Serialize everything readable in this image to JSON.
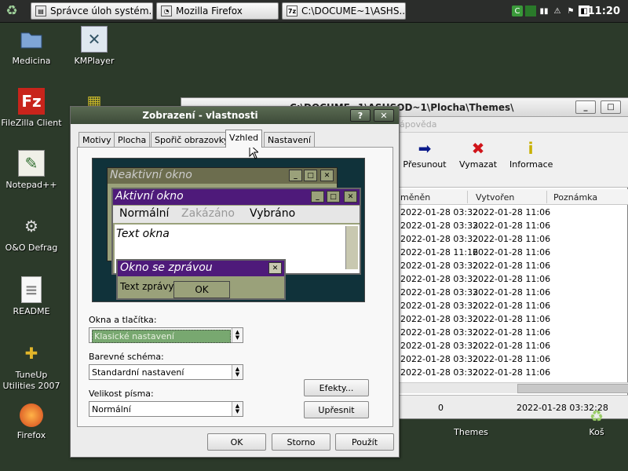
{
  "taskbar": {
    "start_icon": "recycle-leaf-icon",
    "tasks": [
      {
        "label": "Správce úloh systém...",
        "icon": "taskmanager-icon"
      },
      {
        "label": "Mozilla Firefox",
        "icon": "firefox-icon"
      },
      {
        "label": "C:\\DOCUME~1\\ASHS...",
        "icon": "7zip-icon"
      }
    ],
    "tray_icons": [
      "green-c-icon",
      "network-icon",
      "signal-icon",
      "usb-icon",
      "flag-icon",
      "display-icon"
    ],
    "clock": "11:20"
  },
  "desktop_icons": [
    {
      "label": "Medicina",
      "icon": "folder-icon"
    },
    {
      "label": "KMPlayer",
      "icon": "kmplayer-icon"
    },
    {
      "label": "FileZilla Client",
      "icon": "filezilla-icon"
    },
    {
      "label": "Notepad++",
      "icon": "notepad-icon"
    },
    {
      "label": "O&O Defrag",
      "icon": "defrag-icon"
    },
    {
      "label": "README",
      "icon": "text-file-icon"
    },
    {
      "label": "TuneUp Utilities 2007",
      "icon": "tuneup-icon"
    },
    {
      "label": "Firefox",
      "icon": "firefox-icon"
    },
    {
      "label": "Themes",
      "icon": "folder-icon"
    },
    {
      "label": "Koš",
      "icon": "recycle-bin-icon"
    }
  ],
  "explorer": {
    "title": "C:\\DOCUME~1\\ASHSOD~1\\Plocha\\Themes\\",
    "menu_hint": "ápověda",
    "toolbar": [
      {
        "label": "Přesunout",
        "icon": "arrow-right-icon"
      },
      {
        "label": "Vymazat",
        "icon": "delete-x-icon"
      },
      {
        "label": "Informace",
        "icon": "info-icon"
      }
    ],
    "columns": [
      "měněn",
      "Vytvořen",
      "Poznámka"
    ],
    "rows": [
      {
        "modified": "2022-01-28 03:32",
        "created": "2022-01-28 11:06"
      },
      {
        "modified": "2022-01-28 03:33",
        "created": "2022-01-28 11:06"
      },
      {
        "modified": "2022-01-28 03:32",
        "created": "2022-01-28 11:06"
      },
      {
        "modified": "2022-01-28 11:16",
        "created": "2022-01-28 11:06"
      },
      {
        "modified": "2022-01-28 03:32",
        "created": "2022-01-28 11:06"
      },
      {
        "modified": "2022-01-28 03:32",
        "created": "2022-01-28 11:06"
      },
      {
        "modified": "2022-01-28 03:33",
        "created": "2022-01-28 11:06"
      },
      {
        "modified": "2022-01-28 03:32",
        "created": "2022-01-28 11:06"
      },
      {
        "modified": "2022-01-28 03:32",
        "created": "2022-01-28 11:06"
      },
      {
        "modified": "2022-01-28 03:32",
        "created": "2022-01-28 11:06"
      },
      {
        "modified": "2022-01-28 03:32",
        "created": "2022-01-28 11:06"
      },
      {
        "modified": "2022-01-28 03:32",
        "created": "2022-01-28 11:06"
      },
      {
        "modified": "2022-01-28 03:32",
        "created": "2022-01-28 11:06"
      }
    ],
    "status": {
      "count": "0",
      "date": "2022-01-28 03:32:28"
    }
  },
  "dialog": {
    "title": "Zobrazení - vlastnosti",
    "help_label": "?",
    "close_label": "✕",
    "tabs": [
      "Motivy",
      "Plocha",
      "Spořič obrazovky",
      "Vzhled",
      "Nastavení"
    ],
    "active_tab": "Vzhled",
    "preview": {
      "inactive_title": "Neaktivní okno",
      "active_title": "Aktivní okno",
      "menu_normal": "Normální",
      "menu_disabled": "Zakázáno",
      "menu_selected": "Vybráno",
      "window_text": "Text okna",
      "msgbox_title": "Okno se zprávou",
      "msgbox_text": "Text zprávy",
      "ok": "OK"
    },
    "windows_buttons_label": "Okna a tlačítka:",
    "windows_buttons_value": "Klasické nastavení",
    "color_scheme_label": "Barevné schéma:",
    "color_scheme_value": "Standardní nastavení",
    "font_size_label": "Velikost písma:",
    "font_size_value": "Normální",
    "effects_button": "Efekty...",
    "advanced_button": "Upřesnit",
    "ok_button": "OK",
    "cancel_button": "Storno",
    "apply_button": "Použít"
  },
  "colors": {
    "desktop": "#2c3a2a",
    "active_title": "#4e1a7a",
    "inactive_title": "#7a7a5a",
    "preview_bg": "#10323a"
  }
}
